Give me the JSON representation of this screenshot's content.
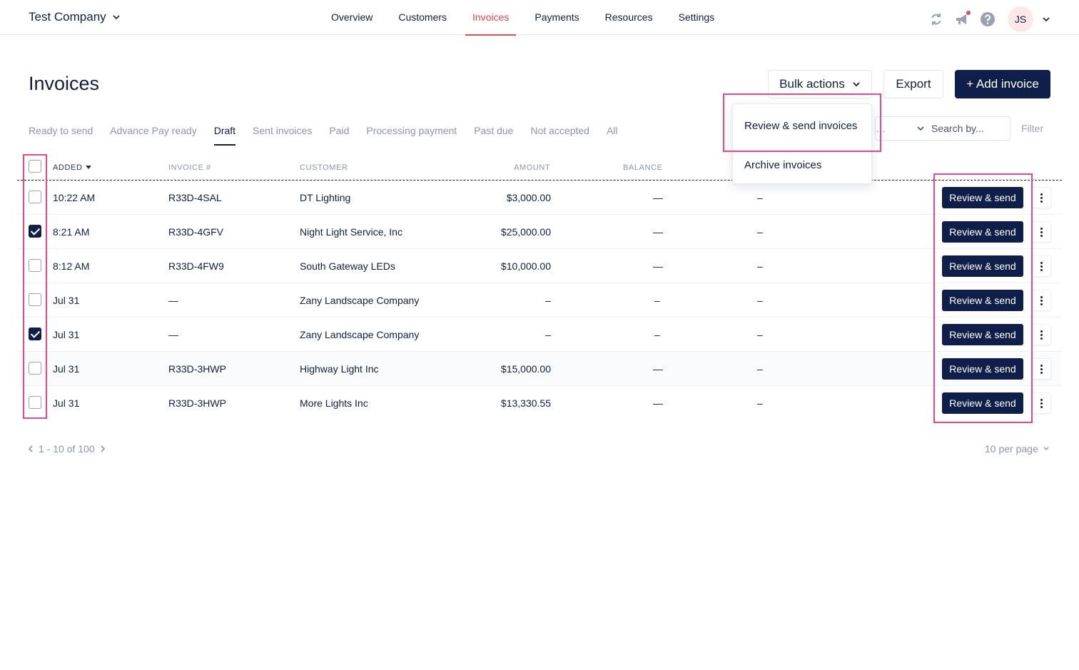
{
  "header": {
    "company": "Test Company",
    "nav": [
      {
        "label": "Overview"
      },
      {
        "label": "Customers"
      },
      {
        "label": "Invoices",
        "active": true
      },
      {
        "label": "Payments"
      },
      {
        "label": "Resources"
      },
      {
        "label": "Settings"
      }
    ],
    "avatar_initials": "JS"
  },
  "page": {
    "title": "Invoices",
    "bulk_actions": "Bulk actions",
    "export": "Export",
    "add_invoice": "+ Add invoice"
  },
  "tabs": [
    {
      "label": "Ready to send"
    },
    {
      "label": "Advance Pay ready"
    },
    {
      "label": "Draft",
      "active": true
    },
    {
      "label": "Sent invoices"
    },
    {
      "label": "Paid"
    },
    {
      "label": "Processing payment"
    },
    {
      "label": "Past due"
    },
    {
      "label": "Not accepted"
    },
    {
      "label": "All"
    }
  ],
  "search": {
    "partial_text": "…",
    "label": "Search by..."
  },
  "filter": "Filter",
  "table": {
    "columns": {
      "added": "ADDED",
      "invoice": "INVOICE #",
      "customer": "CUSTOMER",
      "amount": "AMOUNT",
      "balance": "BALANCE"
    },
    "rows": [
      {
        "added": "10:22 AM",
        "invoice": "R33D-4SAL",
        "customer": "DT Lighting",
        "amount": "$3,000.00",
        "balance": "—",
        "col6": "–",
        "checked": false,
        "action": "Review & send"
      },
      {
        "added": "8:21 AM",
        "invoice": "R33D-4GFV",
        "customer": "Night Light Service, Inc",
        "amount": "$25,000.00",
        "balance": "—",
        "col6": "–",
        "checked": true,
        "action": "Review & send"
      },
      {
        "added": "8:12 AM",
        "invoice": "R33D-4FW9",
        "customer": "South Gateway LEDs",
        "amount": "$10,000.00",
        "balance": "—",
        "col6": "–",
        "checked": false,
        "action": "Review & send"
      },
      {
        "added": "Jul 31",
        "invoice": "—",
        "customer": "Zany Landscape Company",
        "amount": "–",
        "balance": "–",
        "col6": "–",
        "checked": false,
        "action": "Review & send"
      },
      {
        "added": "Jul 31",
        "invoice": "—",
        "customer": "Zany Landscape Company",
        "amount": "–",
        "balance": "–",
        "col6": "–",
        "checked": true,
        "action": "Review & send"
      },
      {
        "added": "Jul 31",
        "invoice": "R33D-3HWP",
        "customer": "Highway Light Inc",
        "amount": "$15,000.00",
        "balance": "—",
        "col6": "–",
        "checked": false,
        "action": "Review & send",
        "highlighted": true
      },
      {
        "added": "Jul 31",
        "invoice": "R33D-3HWP",
        "customer": "More Lights Inc",
        "amount": "$13,330.55",
        "balance": "—",
        "col6": "–",
        "checked": false,
        "action": "Review & send"
      }
    ]
  },
  "pagination": {
    "range": "1 - 10 of 100",
    "per_page": "10 per page"
  },
  "bulk_menu": {
    "items": [
      "Review & send invoices",
      "Archive invoices"
    ]
  },
  "colors": {
    "primary": "#0f1f4a",
    "accent": "#e5484d",
    "annotation": "#f0457f"
  }
}
